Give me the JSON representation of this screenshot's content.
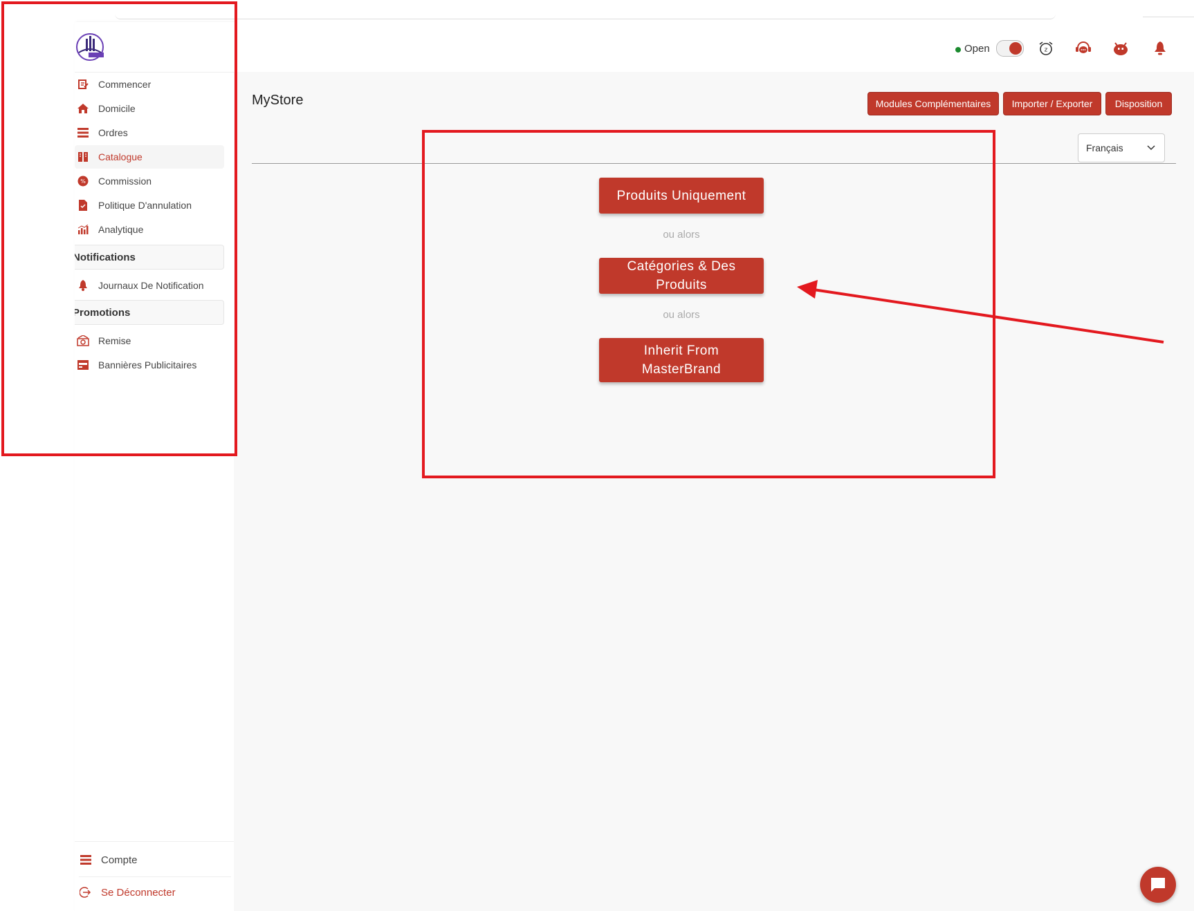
{
  "sidebar": {
    "items": [
      {
        "label": "Commencer",
        "icon": "edit-icon"
      },
      {
        "label": "Domicile",
        "icon": "home-icon"
      },
      {
        "label": "Ordres",
        "icon": "list-icon"
      },
      {
        "label": "Catalogue",
        "icon": "book-icon",
        "active": true
      },
      {
        "label": "Commission",
        "icon": "percent-icon"
      },
      {
        "label": "Politique D'annulation",
        "icon": "document-check-icon"
      },
      {
        "label": "Analytique",
        "icon": "bar-chart-icon"
      }
    ],
    "sections": [
      {
        "title": "Notifications",
        "items": [
          {
            "label": "Journaux De Notification",
            "icon": "bell-icon"
          }
        ]
      },
      {
        "title": "Promotions",
        "items": [
          {
            "label": "Remise",
            "icon": "discount-icon"
          },
          {
            "label": "Bannières Publicitaires",
            "icon": "banner-icon"
          }
        ]
      }
    ],
    "bottom": {
      "account_label": "Compte",
      "logout_label": "Se Déconnecter"
    }
  },
  "header": {
    "status_label": "Open",
    "status_on": true,
    "icons": [
      "alarm-clock-icon",
      "support-chat-icon",
      "bot-icon",
      "bell-icon"
    ]
  },
  "main": {
    "title": "MyStore",
    "actions": {
      "addons": "Modules Complémentaires",
      "import_export": "Importer / Exporter",
      "layout": "Disposition"
    },
    "language": "Français",
    "options": {
      "products_only": "Produits Uniquement",
      "or_1": "ou alors",
      "categories_products": "Catégories & Des Produits",
      "or_2": "ou alors",
      "inherit": "Inherit From MasterBrand"
    }
  },
  "colors": {
    "accent": "#c0392b",
    "annotation": "#e3191f",
    "status_green": "#1a8a2e"
  }
}
